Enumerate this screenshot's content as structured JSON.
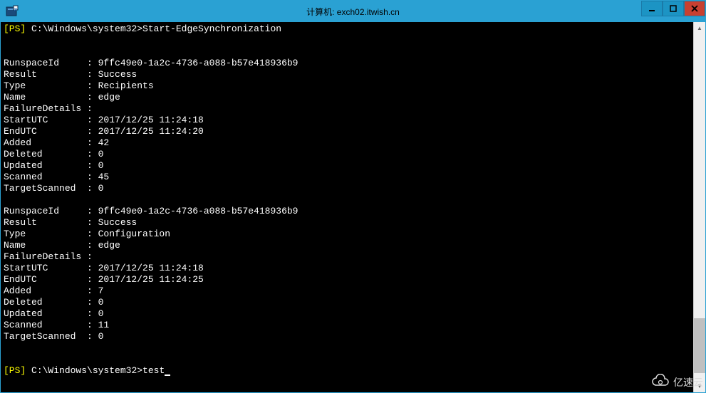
{
  "titlebar": {
    "title": "计算机: exch02.itwish.cn"
  },
  "win_controls": {
    "minimize_icon": "minimize-icon",
    "maximize_icon": "maximize-icon",
    "close_icon": "close-icon"
  },
  "prompt": {
    "ps_tag": "[PS]",
    "path": "C:\\Windows\\system32>",
    "command1": "Start-EdgeSynchronization",
    "command2": "test"
  },
  "blocks": [
    {
      "RunspaceId": "9ffc49e0-1a2c-4736-a088-b57e418936b9",
      "Result": "Success",
      "Type": "Recipients",
      "Name": "edge",
      "FailureDetails": "",
      "StartUTC": "2017/12/25 11:24:18",
      "EndUTC": "2017/12/25 11:24:20",
      "Added": "42",
      "Deleted": "0",
      "Updated": "0",
      "Scanned": "45",
      "TargetScanned": "0"
    },
    {
      "RunspaceId": "9ffc49e0-1a2c-4736-a088-b57e418936b9",
      "Result": "Success",
      "Type": "Configuration",
      "Name": "edge",
      "FailureDetails": "",
      "StartUTC": "2017/12/25 11:24:18",
      "EndUTC": "2017/12/25 11:24:25",
      "Added": "7",
      "Deleted": "0",
      "Updated": "0",
      "Scanned": "11",
      "TargetScanned": "0"
    }
  ],
  "field_order": [
    "RunspaceId",
    "Result",
    "Type",
    "Name",
    "FailureDetails",
    "StartUTC",
    "EndUTC",
    "Added",
    "Deleted",
    "Updated",
    "Scanned",
    "TargetScanned"
  ],
  "watermark": {
    "text": "亿速云"
  }
}
